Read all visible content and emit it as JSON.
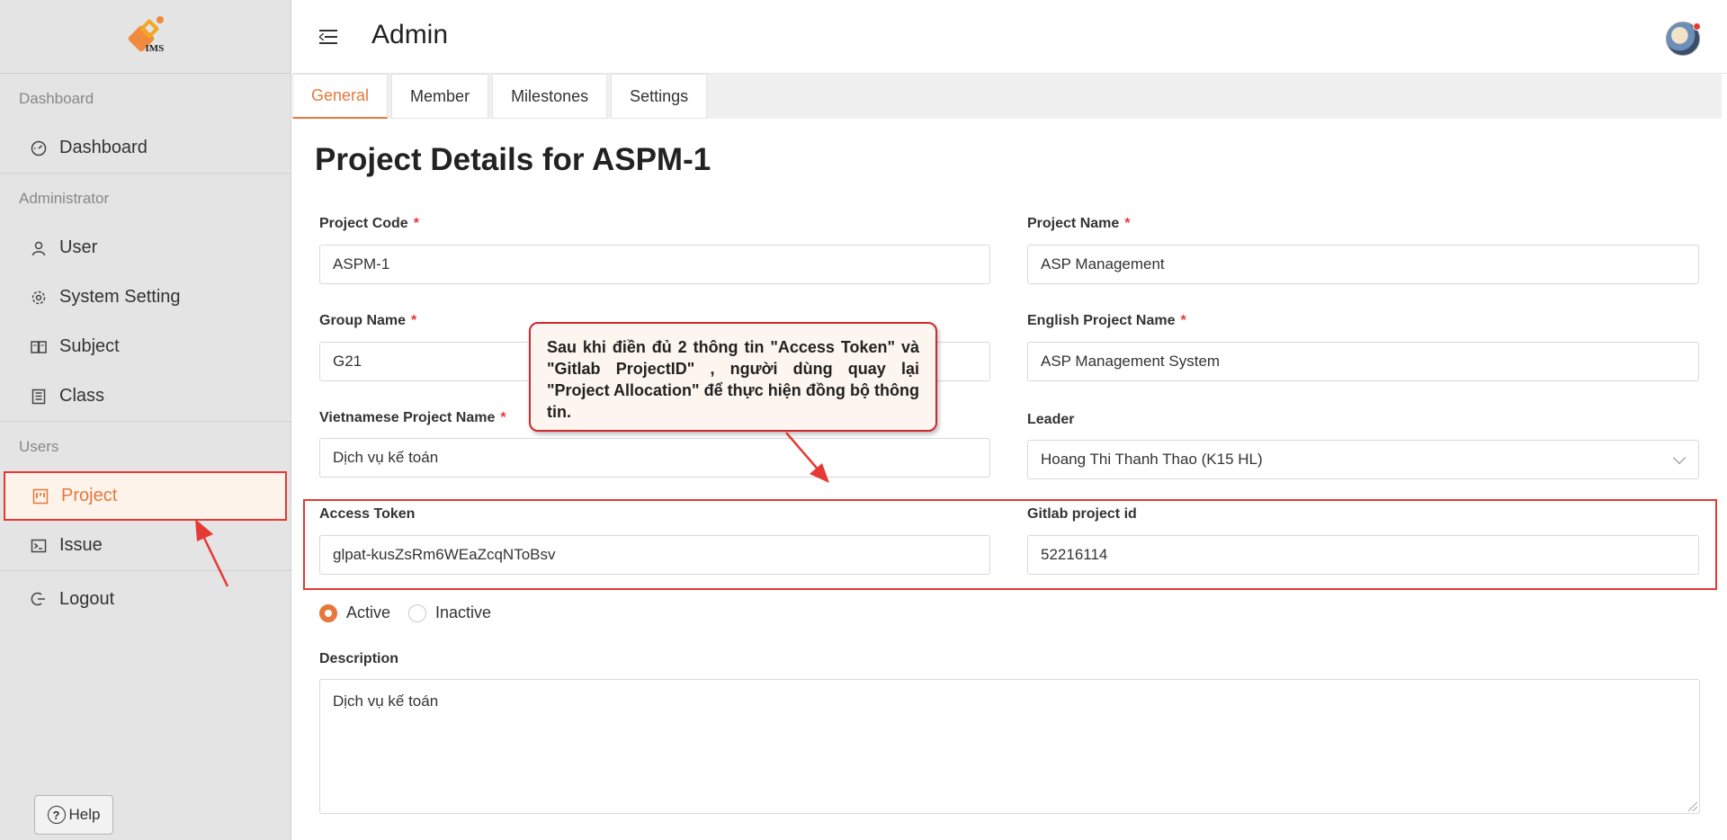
{
  "sidebar": {
    "logo_text": "IMS",
    "sections": [
      {
        "title": "Dashboard",
        "items": [
          {
            "label": "Dashboard",
            "icon": "gauge-icon"
          }
        ]
      },
      {
        "title": "Administrator",
        "items": [
          {
            "label": "User",
            "icon": "user-icon"
          },
          {
            "label": "System Setting",
            "icon": "gear-icon"
          },
          {
            "label": "Subject",
            "icon": "book-icon"
          },
          {
            "label": "Class",
            "icon": "building-icon"
          }
        ]
      },
      {
        "title": "Users",
        "items": [
          {
            "label": "Project",
            "icon": "project-icon",
            "active": true
          },
          {
            "label": "Issue",
            "icon": "terminal-icon"
          }
        ]
      }
    ],
    "logout_label": "Logout",
    "help_label": "Help"
  },
  "header": {
    "title": "Admin"
  },
  "tabs": [
    {
      "label": "General",
      "active": true
    },
    {
      "label": "Member"
    },
    {
      "label": "Milestones"
    },
    {
      "label": "Settings"
    }
  ],
  "page_title": "Project Details for ASPM-1",
  "form": {
    "project_code": {
      "label": "Project Code",
      "value": "ASPM-1"
    },
    "project_name": {
      "label": "Project Name",
      "value": "ASP Management"
    },
    "group_name": {
      "label": "Group Name",
      "value": "G21"
    },
    "english_project_name": {
      "label": "English Project Name",
      "value": "ASP Management System"
    },
    "vietnamese_project_name": {
      "label": "Vietnamese Project Name",
      "value": "Dịch vụ kế toán"
    },
    "leader": {
      "label": "Leader",
      "value": "Hoang Thi Thanh Thao (K15 HL)"
    },
    "access_token": {
      "label": "Access Token",
      "value": "glpat-kusZsRm6WEaZcqNToBsv"
    },
    "gitlab_project_id": {
      "label": "Gitlab project id",
      "value": "52216114"
    },
    "status": {
      "options": [
        "Active",
        "Inactive"
      ],
      "selected": "Active"
    },
    "description": {
      "label": "Description",
      "value": "Dịch vụ kế toán"
    },
    "required_mark": "*"
  },
  "callout": {
    "text": "Sau khi điền đủ 2 thông tin \"Access Token\" và \"Gitlab ProjectID\" , người dùng quay lại \"Project Allocation\" để thực hiện đồng bộ thông tin."
  },
  "colors": {
    "accent": "#e8773a",
    "annotation_red": "#e53935"
  }
}
